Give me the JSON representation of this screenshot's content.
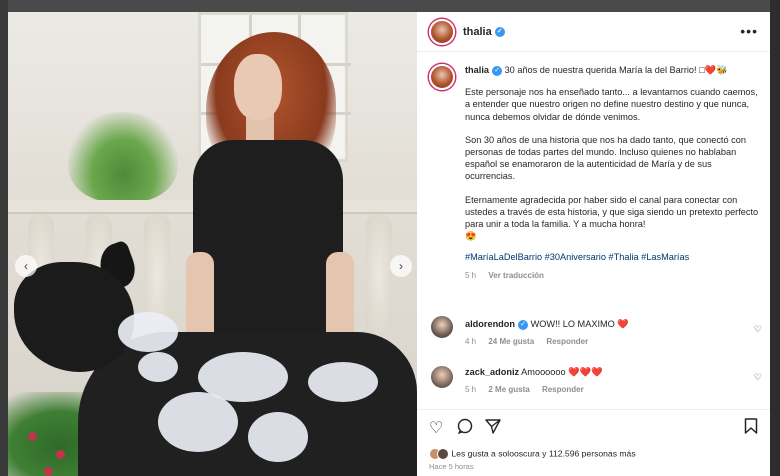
{
  "post": {
    "username": "thalia",
    "caption_lead": "30 años de nuestra querida María la del Barrio! □❤️🐝",
    "caption_p1": "Este personaje nos ha enseñado tanto... a levantarnos cuando caemos, a entender que nuestro origen no define nuestro destino y que nunca, nunca debemos olvidar de dónde venimos.",
    "caption_p2": "Son 30 años de una historia que nos ha dado tanto, que conectó con personas de todas partes del mundo. Incluso quienes no hablaban español se enamoraron de la autenticidad de María y de sus ocurrencias.",
    "caption_p3": "Eternamente agradecida por haber sido el canal para conectar con ustedes a través de esta historia, y que siga siendo un pretexto perfecto para unir a toda la familia. Y a mucha honra!",
    "caption_p3_emoji": "😍",
    "hashtags": "#MaríaLaDelBarrio #30Aniversario #Thalia #LasMarías",
    "time": "5 h",
    "translate": "Ver traducción",
    "more_icon": "more-options-icon"
  },
  "comments": [
    {
      "username": "aldorendon",
      "text": "WOW!! LO MAXIMO ❤️",
      "time": "4 h",
      "likes": "24 Me gusta",
      "reply": "Responder"
    },
    {
      "username": "zack_adoniz",
      "text": "Amoooooo ❤️❤️❤️",
      "time": "5 h",
      "likes": "2 Me gusta",
      "reply": "Responder"
    }
  ],
  "actions": {
    "likes_text": "Les gusta a solooscura y 112.596 personas más",
    "posted_ago": "Hace 5 horas"
  },
  "nav": {
    "prev": "‹",
    "next": "›"
  },
  "colors": {
    "link": "#00376b",
    "verified": "#3897f0",
    "ring": "#d62976"
  }
}
